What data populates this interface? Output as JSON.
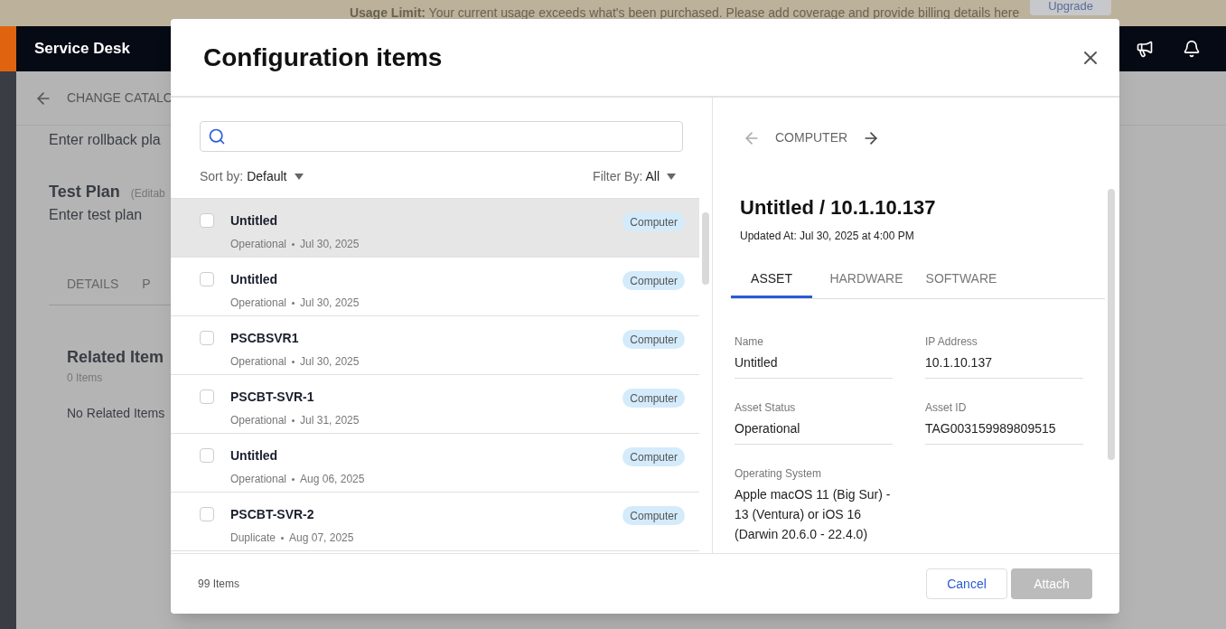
{
  "banner": {
    "text": "**Usage Limit:** Your current usage exceeds what's been purchased. Please add coverage and provide billing details here",
    "button": "Upgrade"
  },
  "header": {
    "title": "Service Desk"
  },
  "page": {
    "breadcrumb": "CHANGE CATALO",
    "rollback": "Enter rollback pla",
    "test_plan_title": "Test Plan",
    "test_plan_note": "(Editab",
    "test_plan_text": "Enter test plan",
    "tabs": [
      {
        "label": "DETAILS",
        "selected": false
      },
      {
        "label": "P",
        "selected": false
      }
    ],
    "related_title": "Related Item",
    "related_count": "0 Items",
    "related_empty": "No Related Items"
  },
  "modal": {
    "title": "Configuration items",
    "sort": {
      "label": "Sort by:",
      "value": "Default"
    },
    "filter": {
      "label": "Filter By:",
      "value": "All"
    },
    "items": [
      {
        "name": "Untitled",
        "status": "Operational",
        "date": "Jul 30, 2025",
        "type": "Computer",
        "checked": false,
        "selected": true
      },
      {
        "name": "Untitled",
        "status": "Operational",
        "date": "Jul 30, 2025",
        "type": "Computer",
        "checked": false,
        "selected": false
      },
      {
        "name": "PSCBSVR1",
        "status": "Operational",
        "date": "Jul 30, 2025",
        "type": "Computer",
        "checked": false,
        "selected": false
      },
      {
        "name": "PSCBT-SVR-1",
        "status": "Operational",
        "date": "Jul 31, 2025",
        "type": "Computer",
        "checked": false,
        "selected": false
      },
      {
        "name": "Untitled",
        "status": "Operational",
        "date": "Aug 06, 2025",
        "type": "Computer",
        "checked": false,
        "selected": false
      },
      {
        "name": "PSCBT-SVR-2",
        "status": "Duplicate",
        "date": "Aug 07, 2025",
        "type": "Computer",
        "checked": false,
        "selected": false
      }
    ],
    "count": "99 Items",
    "detail": {
      "category": "COMPUTER",
      "title": "Untitled / 10.1.10.137",
      "updated": "Updated At: Jul 30, 2025 at 4:00 PM",
      "tabs": [
        {
          "label": "ASSET",
          "selected": true
        },
        {
          "label": "HARDWARE",
          "selected": false
        },
        {
          "label": "SOFTWARE",
          "selected": false
        }
      ],
      "fields": [
        {
          "label": "Name",
          "value": "Untitled"
        },
        {
          "label": "IP Address",
          "value": "10.1.10.137"
        },
        {
          "label": "Asset Status",
          "value": "Operational"
        },
        {
          "label": "Asset ID",
          "value": "TAG003159989809515"
        },
        {
          "label": "Operating System",
          "value": "Apple macOS 11 (Big Sur) - 13 (Ventura) or iOS 16 (Darwin 20.6.0 - 22.4.0)"
        }
      ]
    },
    "buttons": [
      {
        "label": "Cancel",
        "disabled": false
      },
      {
        "label": "Attach",
        "disabled": true
      }
    ]
  }
}
